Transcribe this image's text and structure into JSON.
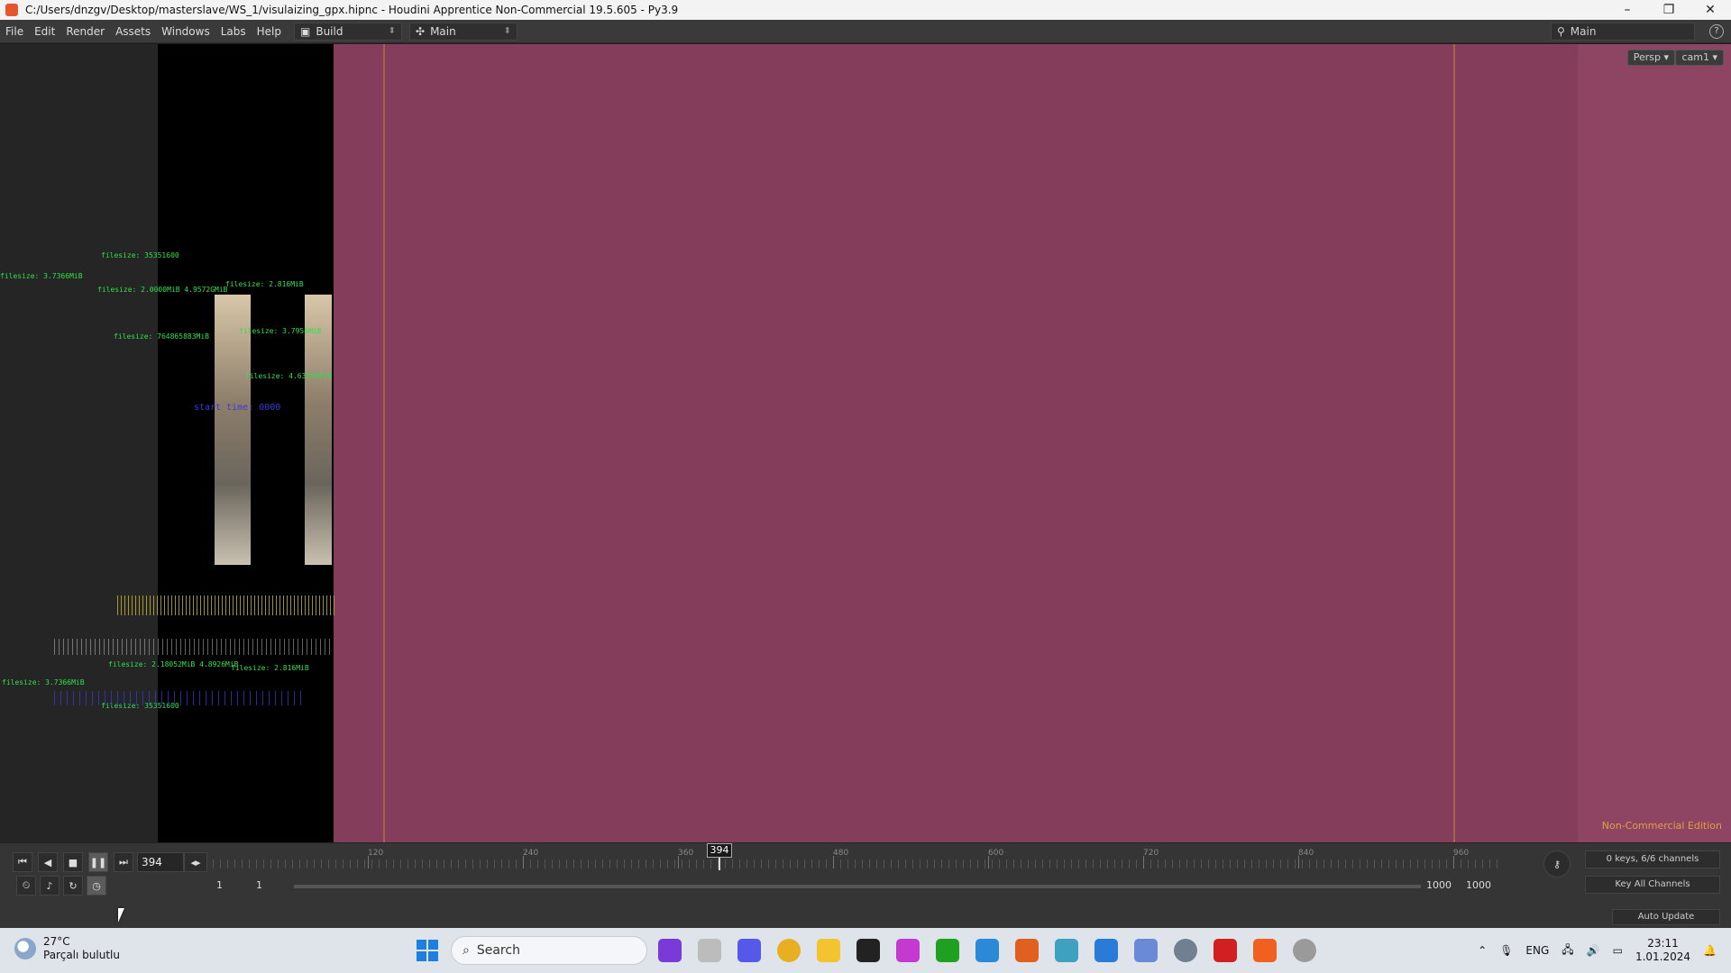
{
  "window": {
    "title": "C:/Users/dnzgv/Desktop/masterslave/WS_1/visulaizing_gpx.hipnc - Houdini Apprentice Non-Commercial 19.5.605 - Py3.9",
    "minimize": "–",
    "maximize": "❐",
    "close": "✕"
  },
  "menubar": {
    "items": [
      "File",
      "Edit",
      "Render",
      "Assets",
      "Windows",
      "Labs",
      "Help"
    ],
    "desktop_left": "Build",
    "desktop_mid": "Main",
    "desktop_right": "Main",
    "help": "?"
  },
  "viewport": {
    "camera_menu": "Persp ▾",
    "cam_menu": "cam1 ▾",
    "edition_label": "Non-Commercial Edition",
    "overlay_text": [
      {
        "text": "filesize: 35351600",
        "c": "g"
      },
      {
        "text": "filesize: 3.7366MiB",
        "c": "g"
      },
      {
        "text": "filesize: 2.0000MiB  4.9572GMiB",
        "c": "g"
      },
      {
        "text": "filesize: 2.816MiB",
        "c": "g"
      },
      {
        "text": "filesize: 3.7956MiB",
        "c": "g"
      },
      {
        "text": "filesize: 4.63265MiB",
        "c": "g"
      },
      {
        "text": "filesize: 764865883MiB",
        "c": "g"
      },
      {
        "text": "filesize: 2.18052MiB  4.8926MiB",
        "c": "g"
      },
      {
        "text": "filesize: 2.816MiB",
        "c": "g"
      },
      {
        "text": "filesize: 3.7366MiB",
        "c": "g"
      },
      {
        "text": "filesize: 35351600",
        "c": "g"
      },
      {
        "text": "start time: 0000",
        "c": "b"
      }
    ]
  },
  "timeline": {
    "current_frame": "394",
    "ruler_labels": [
      "120",
      "240",
      "360",
      "480",
      "600",
      "720",
      "840",
      "960"
    ],
    "marker": "394",
    "range_start": "1",
    "range_start2": "1",
    "range_end": "1000",
    "range_end2": "1000",
    "keys_info": "0 keys, 6/6 channels",
    "key_all": "Key All Channels",
    "auto_update": "Auto Update"
  },
  "taskbar": {
    "temp": "27°C",
    "weather": "Parçalı bulutlu",
    "search_placeholder": "Search",
    "lang": "ENG",
    "time": "23:11",
    "date": "1.01.2024"
  }
}
